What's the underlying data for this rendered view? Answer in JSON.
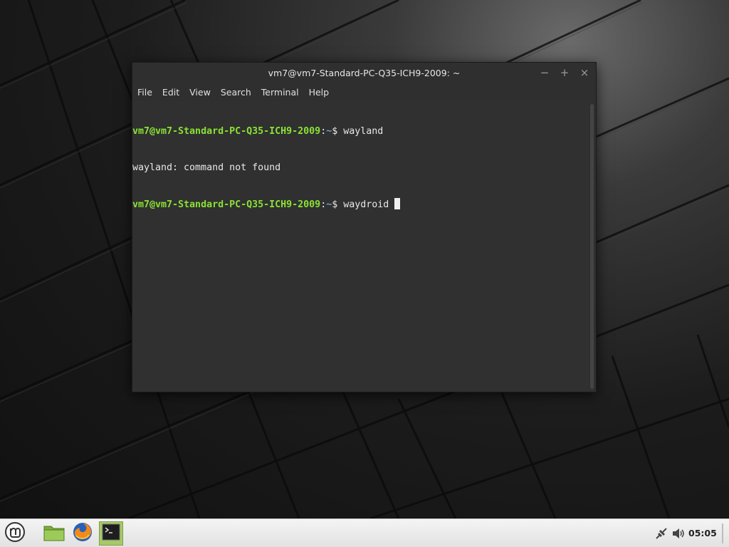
{
  "window": {
    "title": "vm7@vm7-Standard-PC-Q35-ICH9-2009: ~",
    "controls": {
      "minimize": "−",
      "maximize": "+",
      "close": "×"
    }
  },
  "menubar": {
    "items": [
      "File",
      "Edit",
      "View",
      "Search",
      "Terminal",
      "Help"
    ]
  },
  "terminal": {
    "lines": [
      {
        "prompt_user": "vm7@vm7-Standard-PC-Q35-ICH9-2009",
        "prompt_path": "~",
        "command": "wayland"
      },
      {
        "output": "wayland: command not found"
      },
      {
        "prompt_user": "vm7@vm7-Standard-PC-Q35-ICH9-2009",
        "prompt_path": "~",
        "command": "waydroid "
      }
    ],
    "colors": {
      "user": "#8ae234",
      "path": "#729fcf",
      "text": "#e8e8e8",
      "background": "#303030"
    }
  },
  "panel": {
    "launchers": [
      {
        "icon": "linux-mint-menu-icon"
      },
      {
        "icon": "files-folder-icon"
      },
      {
        "icon": "firefox-icon"
      },
      {
        "icon": "terminal-icon",
        "active": true
      }
    ],
    "tray": [
      {
        "icon": "network-disconnected-icon"
      },
      {
        "icon": "volume-icon"
      }
    ],
    "clock": "05:05",
    "accent": "#a7c96a"
  }
}
